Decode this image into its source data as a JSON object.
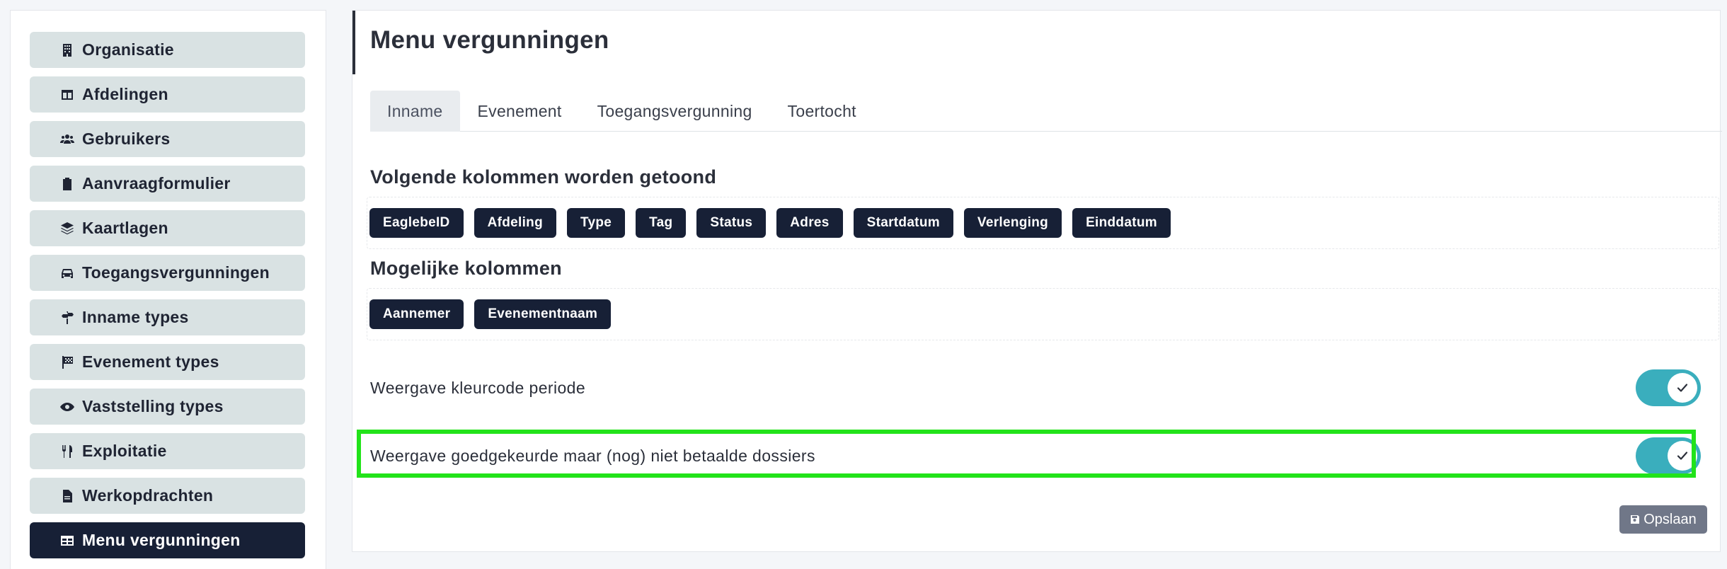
{
  "sidebar": {
    "items": [
      {
        "label": "Organisatie",
        "icon": "building-icon"
      },
      {
        "label": "Afdelingen",
        "icon": "columns-icon"
      },
      {
        "label": "Gebruikers",
        "icon": "users-icon"
      },
      {
        "label": "Aanvraagformulier",
        "icon": "clipboard-icon"
      },
      {
        "label": "Kaartlagen",
        "icon": "layers-icon"
      },
      {
        "label": "Toegangsvergunningen",
        "icon": "car-icon"
      },
      {
        "label": "Inname types",
        "icon": "signs-icon"
      },
      {
        "label": "Evenement types",
        "icon": "checkered-flag-icon"
      },
      {
        "label": "Vaststelling types",
        "icon": "eye-icon"
      },
      {
        "label": "Exploitatie",
        "icon": "utensils-icon"
      },
      {
        "label": "Werkopdrachten",
        "icon": "file-icon"
      },
      {
        "label": "Menu vergunningen",
        "icon": "table-icon",
        "active": true
      }
    ]
  },
  "main": {
    "title": "Menu vergunningen",
    "tabs": [
      {
        "label": "Inname",
        "active": true
      },
      {
        "label": "Evenement"
      },
      {
        "label": "Toegangsvergunning"
      },
      {
        "label": "Toertocht"
      }
    ],
    "shown_section": {
      "title": "Volgende kolommen worden getoond",
      "columns": [
        "EaglebeID",
        "Afdeling",
        "Type",
        "Tag",
        "Status",
        "Adres",
        "Startdatum",
        "Verlenging",
        "Einddatum"
      ]
    },
    "possible_section": {
      "title": "Mogelijke kolommen",
      "columns": [
        "Aannemer",
        "Evenementnaam"
      ]
    },
    "settings": [
      {
        "label": "Weergave kleurcode periode",
        "enabled": true
      },
      {
        "label": "Weergave goedgekeurde maar (nog) niet betaalde dossiers",
        "enabled": true,
        "highlighted": true
      }
    ],
    "save_label": "Opslaan"
  },
  "colors": {
    "sidebar_item_bg": "#d9e2e3",
    "sidebar_active_bg": "#172036",
    "chip_bg": "#172036",
    "toggle_on": "#3aaebd",
    "highlight_border": "#22e31a",
    "save_button_bg": "#707788"
  }
}
